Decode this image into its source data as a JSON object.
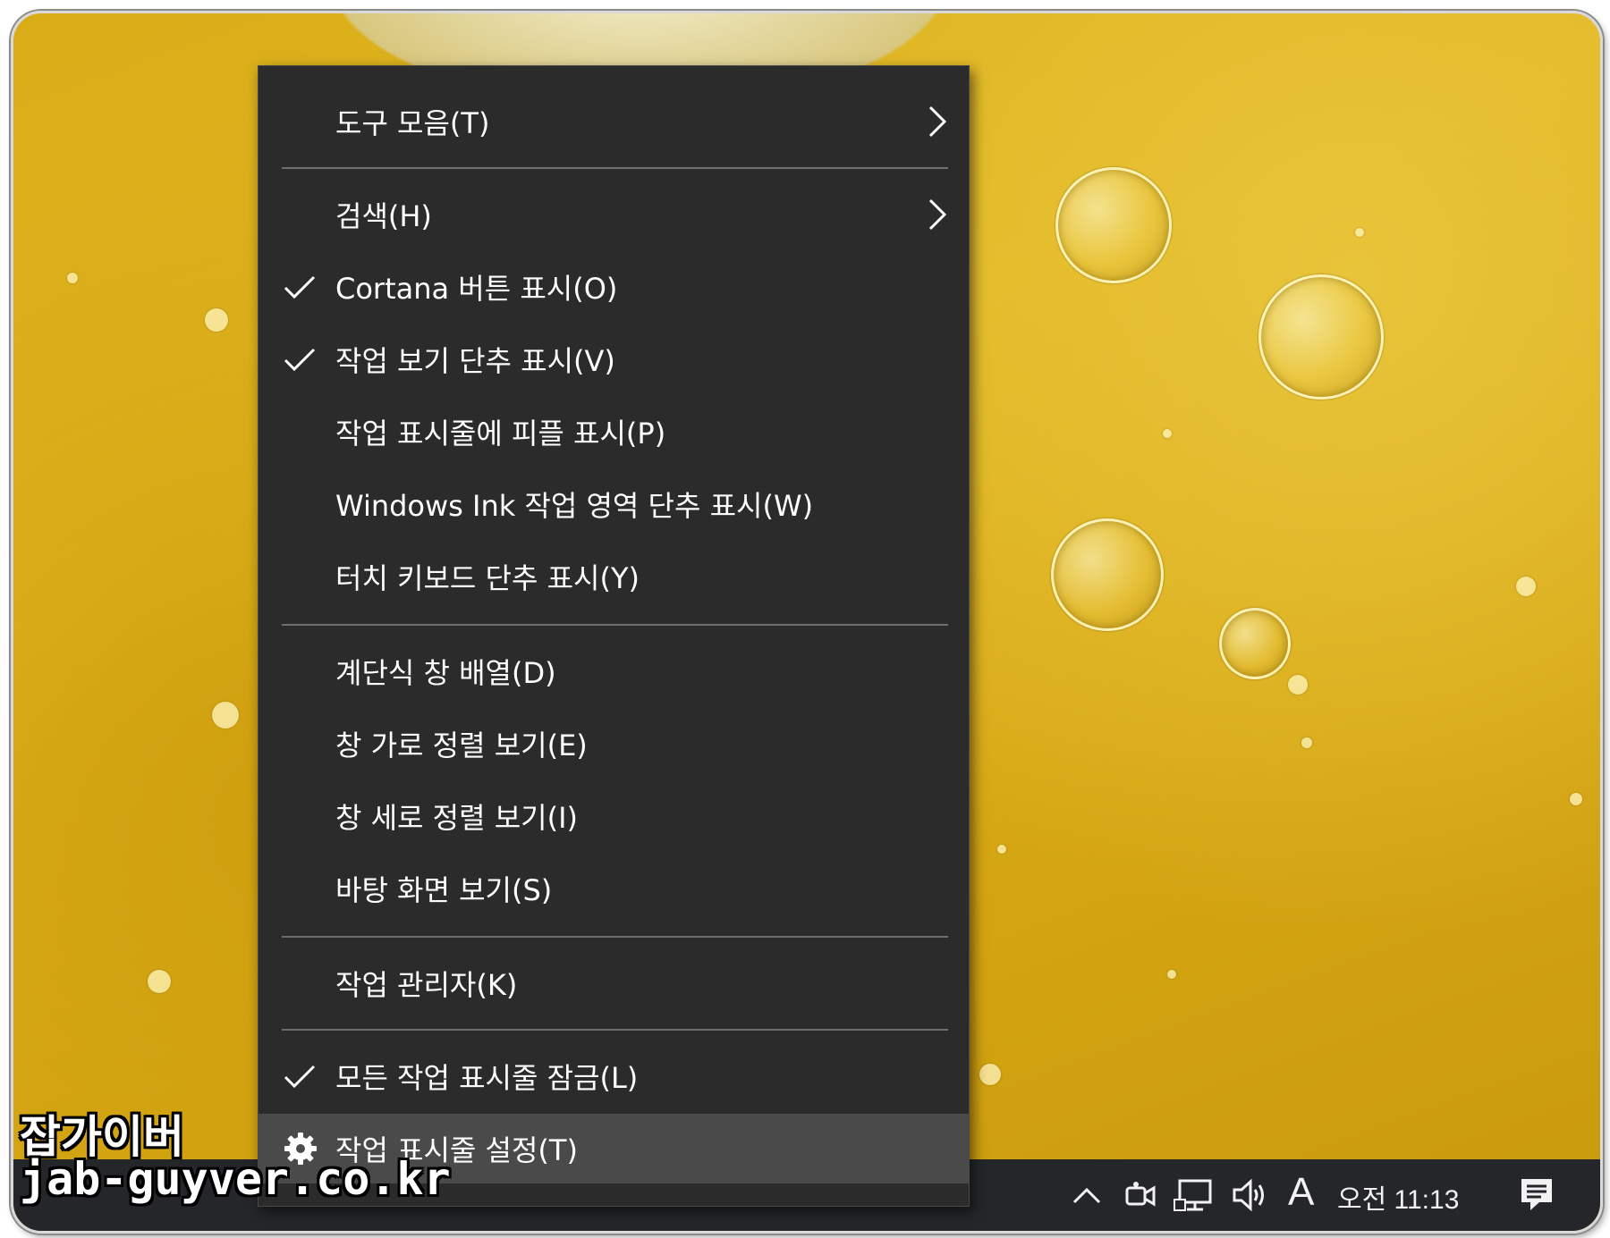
{
  "menu": {
    "items": [
      {
        "label": "도구 모음(T)",
        "checked": false,
        "submenu": true
      },
      {
        "label": "검색(H)",
        "checked": false,
        "submenu": true
      },
      {
        "label": "Cortana 버튼 표시(O)",
        "checked": true,
        "submenu": false
      },
      {
        "label": "작업 보기 단추 표시(V)",
        "checked": true,
        "submenu": false
      },
      {
        "label": "작업 표시줄에 피플 표시(P)",
        "checked": false,
        "submenu": false
      },
      {
        "label": "Windows Ink 작업 영역 단추 표시(W)",
        "checked": false,
        "submenu": false
      },
      {
        "label": "터치 키보드 단추 표시(Y)",
        "checked": false,
        "submenu": false
      },
      {
        "label": "계단식 창 배열(D)",
        "checked": false,
        "submenu": false
      },
      {
        "label": "창 가로 정렬 보기(E)",
        "checked": false,
        "submenu": false
      },
      {
        "label": "창 세로 정렬 보기(I)",
        "checked": false,
        "submenu": false
      },
      {
        "label": "바탕 화면 보기(S)",
        "checked": false,
        "submenu": false
      },
      {
        "label": "작업 관리자(K)",
        "checked": false,
        "submenu": false
      },
      {
        "label": "모든 작업 표시줄 잠금(L)",
        "checked": true,
        "submenu": false
      },
      {
        "label": "작업 표시줄 설정(T)",
        "checked": false,
        "submenu": false,
        "icon": "gear-icon",
        "highlighted": true
      }
    ]
  },
  "taskbar": {
    "ime_indicator": "A",
    "clock": "오전 11:13",
    "tray_icons": [
      "chevron-up-icon",
      "meet-now-icon",
      "network-icon",
      "volume-icon",
      "notification-icon"
    ],
    "background": "#24262a"
  },
  "watermark": {
    "line1": "잡가이버",
    "line2": "jab-guyver.co.kr"
  },
  "colors": {
    "menu_bg": "#2b2b2b",
    "menu_highlight": "#4a4a4a",
    "separator": "#6e6e6e",
    "wallpaper": "#d9ad18"
  }
}
